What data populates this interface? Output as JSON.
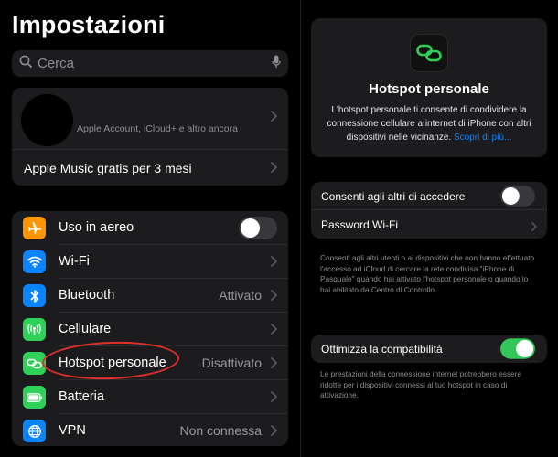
{
  "settings_pane": {
    "title": "Impostazioni",
    "search": {
      "placeholder": "Cerca",
      "icon": "magnifying-glass-icon",
      "mic_icon": "microphone-icon"
    },
    "account": {
      "subtitle": "Apple Account, iCloud+ e altro ancora",
      "promo": "Apple Music gratis per 3 mesi"
    },
    "rows": [
      {
        "label": "Uso in aereo",
        "value": "",
        "icon": "airplane-icon",
        "icon_color": "#ff9500",
        "toggle": false
      },
      {
        "label": "Wi-Fi",
        "value": "",
        "icon": "wifi-icon",
        "icon_color": "#0a84ff"
      },
      {
        "label": "Bluetooth",
        "value": "Attivato",
        "icon": "bluetooth-icon",
        "icon_color": "#0a84ff"
      },
      {
        "label": "Cellulare",
        "value": "",
        "icon": "antenna-icon",
        "icon_color": "#30d158"
      },
      {
        "label": "Hotspot personale",
        "value": "Disattivato",
        "icon": "link-icon",
        "icon_color": "#30d158"
      },
      {
        "label": "Batteria",
        "value": "",
        "icon": "battery-icon",
        "icon_color": "#30d158"
      },
      {
        "label": "VPN",
        "value": "Non connessa",
        "icon": "globe-icon",
        "icon_color": "#0a84ff"
      }
    ]
  },
  "detail_pane": {
    "title": "Hotspot personale",
    "description": "L'hotspot personale ti consente di condividere la connessione cellulare a internet di iPhone con altri dispositivi nelle vicinanze.",
    "learn_more": "Scopri di più...",
    "allow_others_label": "Consenti agli altri di accedere",
    "allow_others_on": false,
    "wifi_password_label": "Password Wi-Fi",
    "note1": "Consenti agli altri utenti o ai dispositivi che non hanno effettuato l'accesso ad iCloud di cercare la rete condivisa \"iPhone di Pasquale\" quando hai attivato l'hotspot personale o quando lo hai abilitato da Centro di Controllo.",
    "compat_label": "Ottimizza la compatibilità",
    "compat_on": true,
    "note2": "Le prestazioni della connessione internet potrebbero essere ridotte per i dispositivi connessi al tuo hotspot in caso di attivazione."
  },
  "colors": {
    "accent": "#0a84ff",
    "toggle_on": "#33c759",
    "highlight_circle": "#e0302a"
  }
}
